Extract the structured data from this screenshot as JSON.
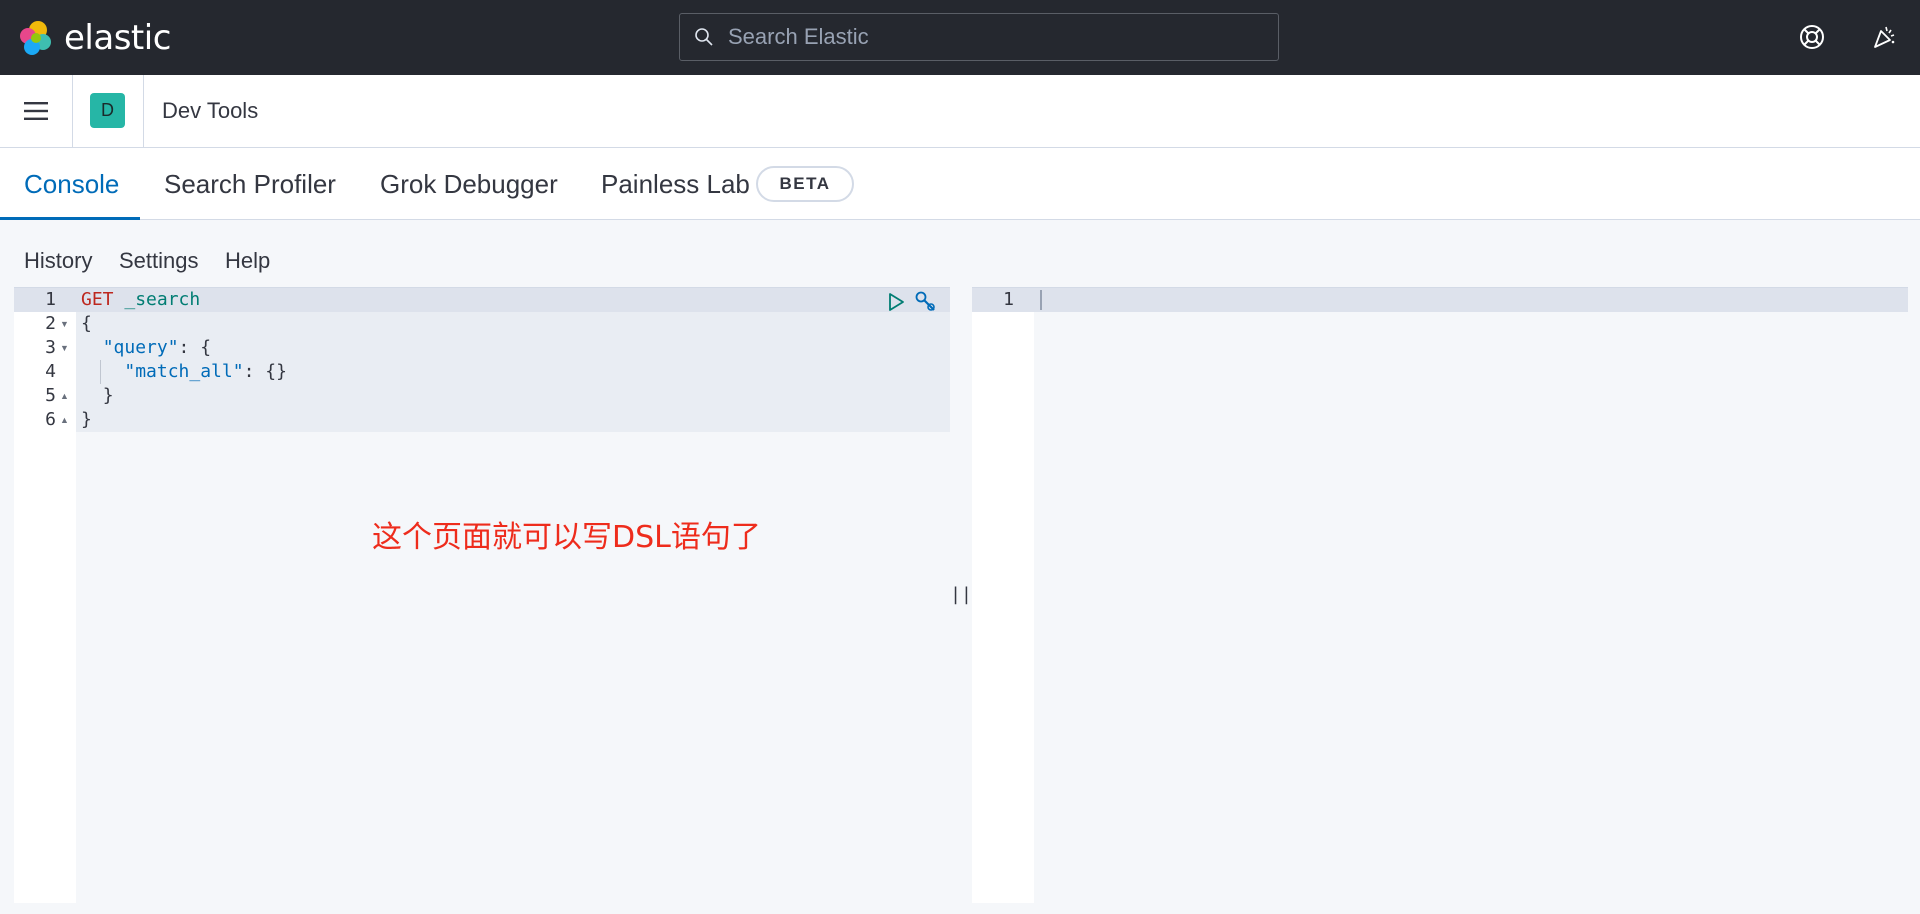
{
  "header": {
    "brand": "elastic",
    "search_placeholder": "Search Elastic"
  },
  "breadcrumb": {
    "space_initial": "D",
    "current": "Dev Tools"
  },
  "tabs": [
    {
      "label": "Console",
      "active": true
    },
    {
      "label": "Search Profiler",
      "active": false
    },
    {
      "label": "Grok Debugger",
      "active": false
    },
    {
      "label": "Painless Lab",
      "active": false,
      "badge": "BETA"
    }
  ],
  "console_menu": {
    "history": "History",
    "settings": "Settings",
    "help": "Help"
  },
  "editor": {
    "line_numbers": [
      "1",
      "2",
      "3",
      "4",
      "5",
      "6"
    ],
    "lines": {
      "l1_method": "GET",
      "l1_url": "_search",
      "l2": "{",
      "l3_key": "\"query\"",
      "l3_rest": ": {",
      "l4_key": "\"match_all\"",
      "l4_rest": ": {}",
      "l5": "}",
      "l6": "}"
    }
  },
  "annotation": "这个页面就可以写DSL语句了",
  "output": {
    "line_numbers": [
      "1"
    ]
  },
  "colors": {
    "accent": "#006bb8",
    "topbar": "#25282f",
    "method": "#bd271e",
    "url": "#017d73",
    "annotation": "#ee2c1c"
  }
}
